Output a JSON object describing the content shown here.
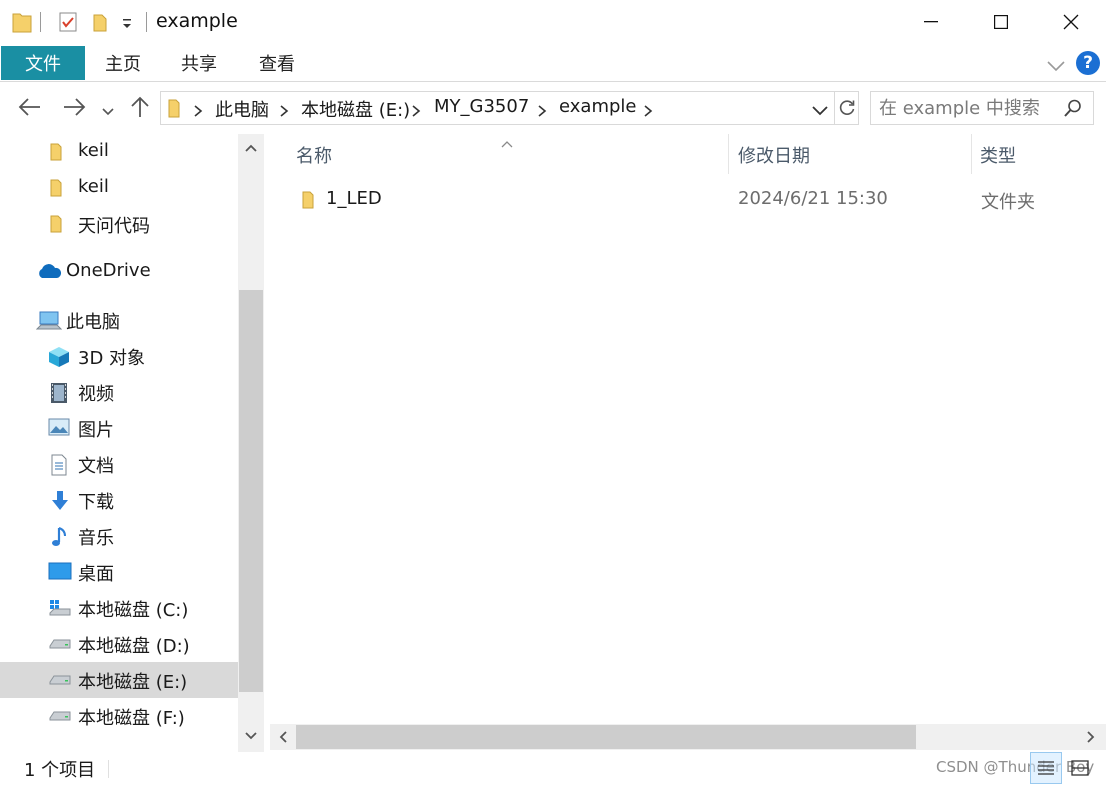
{
  "window": {
    "title": "example"
  },
  "ribbon": {
    "tabs": [
      {
        "label": "文件",
        "active": true
      },
      {
        "label": "主页"
      },
      {
        "label": "共享"
      },
      {
        "label": "查看"
      }
    ],
    "help_label": "?"
  },
  "address": {
    "crumbs": [
      "此电脑",
      "本地磁盘 (E:)",
      "MY_G3507",
      "example"
    ]
  },
  "search": {
    "placeholder": "在 example 中搜索"
  },
  "nav": {
    "items": [
      {
        "label": "keil",
        "icon": "folder-icon"
      },
      {
        "label": "keil",
        "icon": "folder-icon"
      },
      {
        "label": "天问代码",
        "icon": "folder-icon"
      },
      {
        "label": "OneDrive",
        "icon": "onedrive-cloud-icon"
      },
      {
        "label": "此电脑",
        "icon": "this-pc-icon"
      },
      {
        "label": "3D 对象",
        "icon": "3d-objects-icon"
      },
      {
        "label": "视频",
        "icon": "videos-icon"
      },
      {
        "label": "图片",
        "icon": "pictures-icon"
      },
      {
        "label": "文档",
        "icon": "documents-icon"
      },
      {
        "label": "下载",
        "icon": "downloads-icon"
      },
      {
        "label": "音乐",
        "icon": "music-icon"
      },
      {
        "label": "桌面",
        "icon": "desktop-icon"
      },
      {
        "label": "本地磁盘 (C:)",
        "icon": "windows-drive-icon"
      },
      {
        "label": "本地磁盘 (D:)",
        "icon": "drive-icon"
      },
      {
        "label": "本地磁盘 (E:)",
        "icon": "drive-icon",
        "selected": true
      },
      {
        "label": "本地磁盘 (F:)",
        "icon": "drive-icon"
      }
    ]
  },
  "columns": {
    "name": "名称",
    "date": "修改日期",
    "type": "类型"
  },
  "files": [
    {
      "name": "1_LED",
      "date": "2024/6/21 15:30",
      "type": "文件夹",
      "icon": "folder-icon"
    }
  ],
  "status": {
    "count": "1 个项目",
    "watermark": "CSDN @Thunder Boy"
  },
  "colors": {
    "accent": "#1a8fa3",
    "selection": "#d9d9d9",
    "folder": "#f2c94c"
  }
}
